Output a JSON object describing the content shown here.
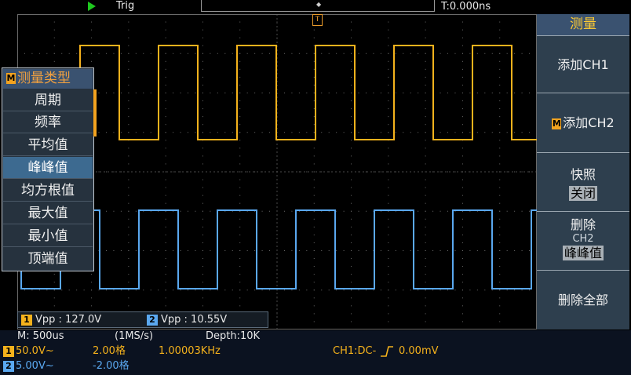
{
  "header": {
    "trig_label": "Trig",
    "time_offset": "T:0.000ns"
  },
  "trigger_marker": "T",
  "side_menu": {
    "title": "测量",
    "add_ch1": "添加CH1",
    "add_ch2": "添加CH2",
    "add_ch2_badge": "M",
    "snapshot_label": "快照",
    "snapshot_value": "关闭",
    "delete_label": "删除",
    "delete_channel": "CH2",
    "delete_value": "峰峰值",
    "delete_all": "删除全部"
  },
  "measure_menu": {
    "badge": "M",
    "title": "测量类型",
    "items": [
      "周期",
      "频率",
      "平均值",
      "峰峰值",
      "均方根值",
      "最大值",
      "最小值",
      "顶端值"
    ],
    "selected_index": 3
  },
  "readout": {
    "ch1_badge": "1",
    "ch1_text": "Vpp : 127.0V",
    "ch2_badge": "2",
    "ch2_text": "Vpp : 10.55V"
  },
  "status": {
    "timebase": "M: 500us",
    "sample_rate": "(1MS/s)",
    "depth": "Depth:10K",
    "ch1_badge": "1",
    "ch1_scale": "50.0V~",
    "ch1_pos": "2.00格",
    "frequency": "1.00003KHz",
    "trigger_info_prefix": "CH1:DC-",
    "trigger_level": "0.00mV",
    "ch2_badge": "2",
    "ch2_scale": "5.00V~",
    "ch2_pos": "-2.00格"
  },
  "colors": {
    "ch1": "#f5b21c",
    "ch2": "#5aa8f0",
    "menu_accent": "#f3a31f"
  }
}
